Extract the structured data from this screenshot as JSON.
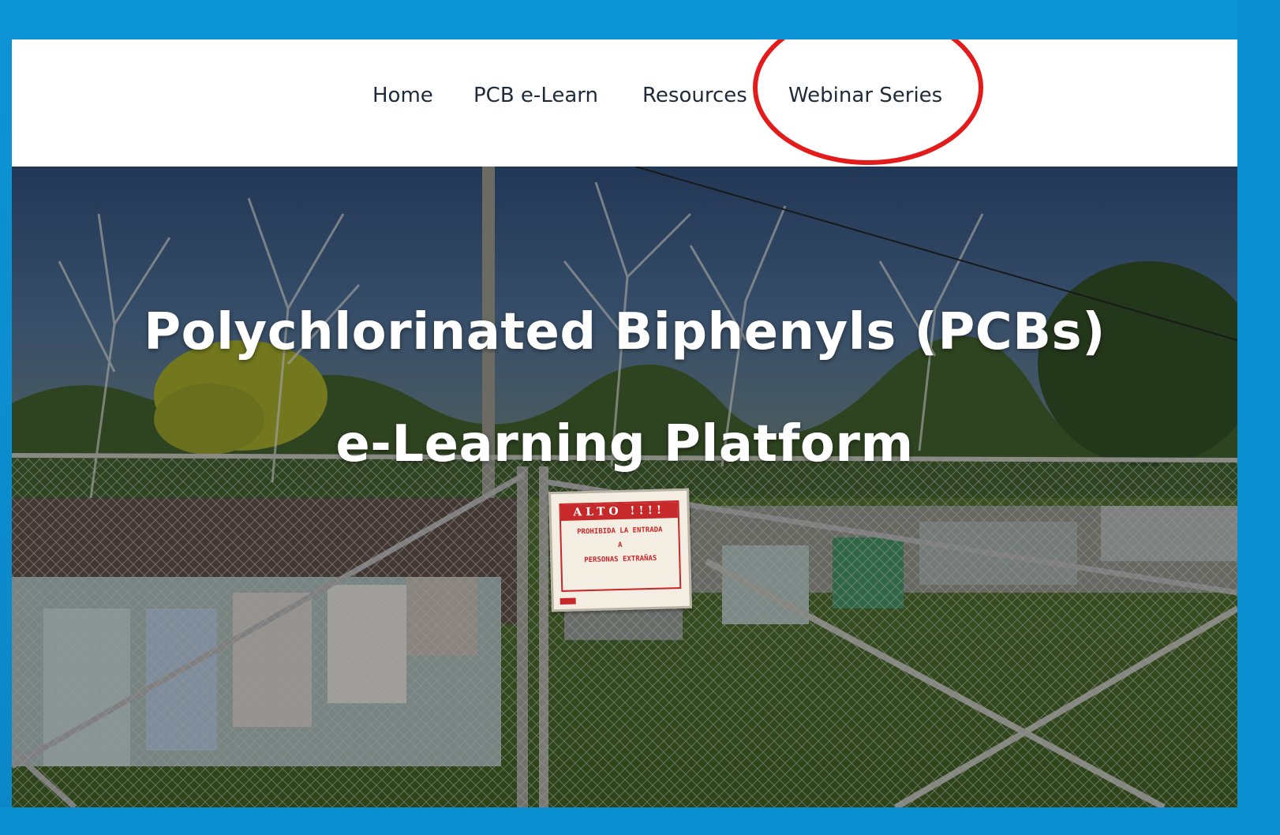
{
  "nav": {
    "items": [
      {
        "label": "Home"
      },
      {
        "label": "PCB e-Learn"
      },
      {
        "label": "Resources"
      },
      {
        "label": "Webinar Series"
      }
    ]
  },
  "hero": {
    "title_line1": "Polychlorinated Biphenyls (PCBs)",
    "title_line2": "e-Learning Platform"
  },
  "sign": {
    "header": "ALTO !!!!",
    "line1": "PROHIBIDA LA ENTRADA",
    "line2": "A",
    "line3": "PERSONAS EXTRAÑAS"
  },
  "colors": {
    "frame": "#0a8fd0",
    "highlight": "#e41b1b",
    "nav_text": "#1f2b3a"
  }
}
